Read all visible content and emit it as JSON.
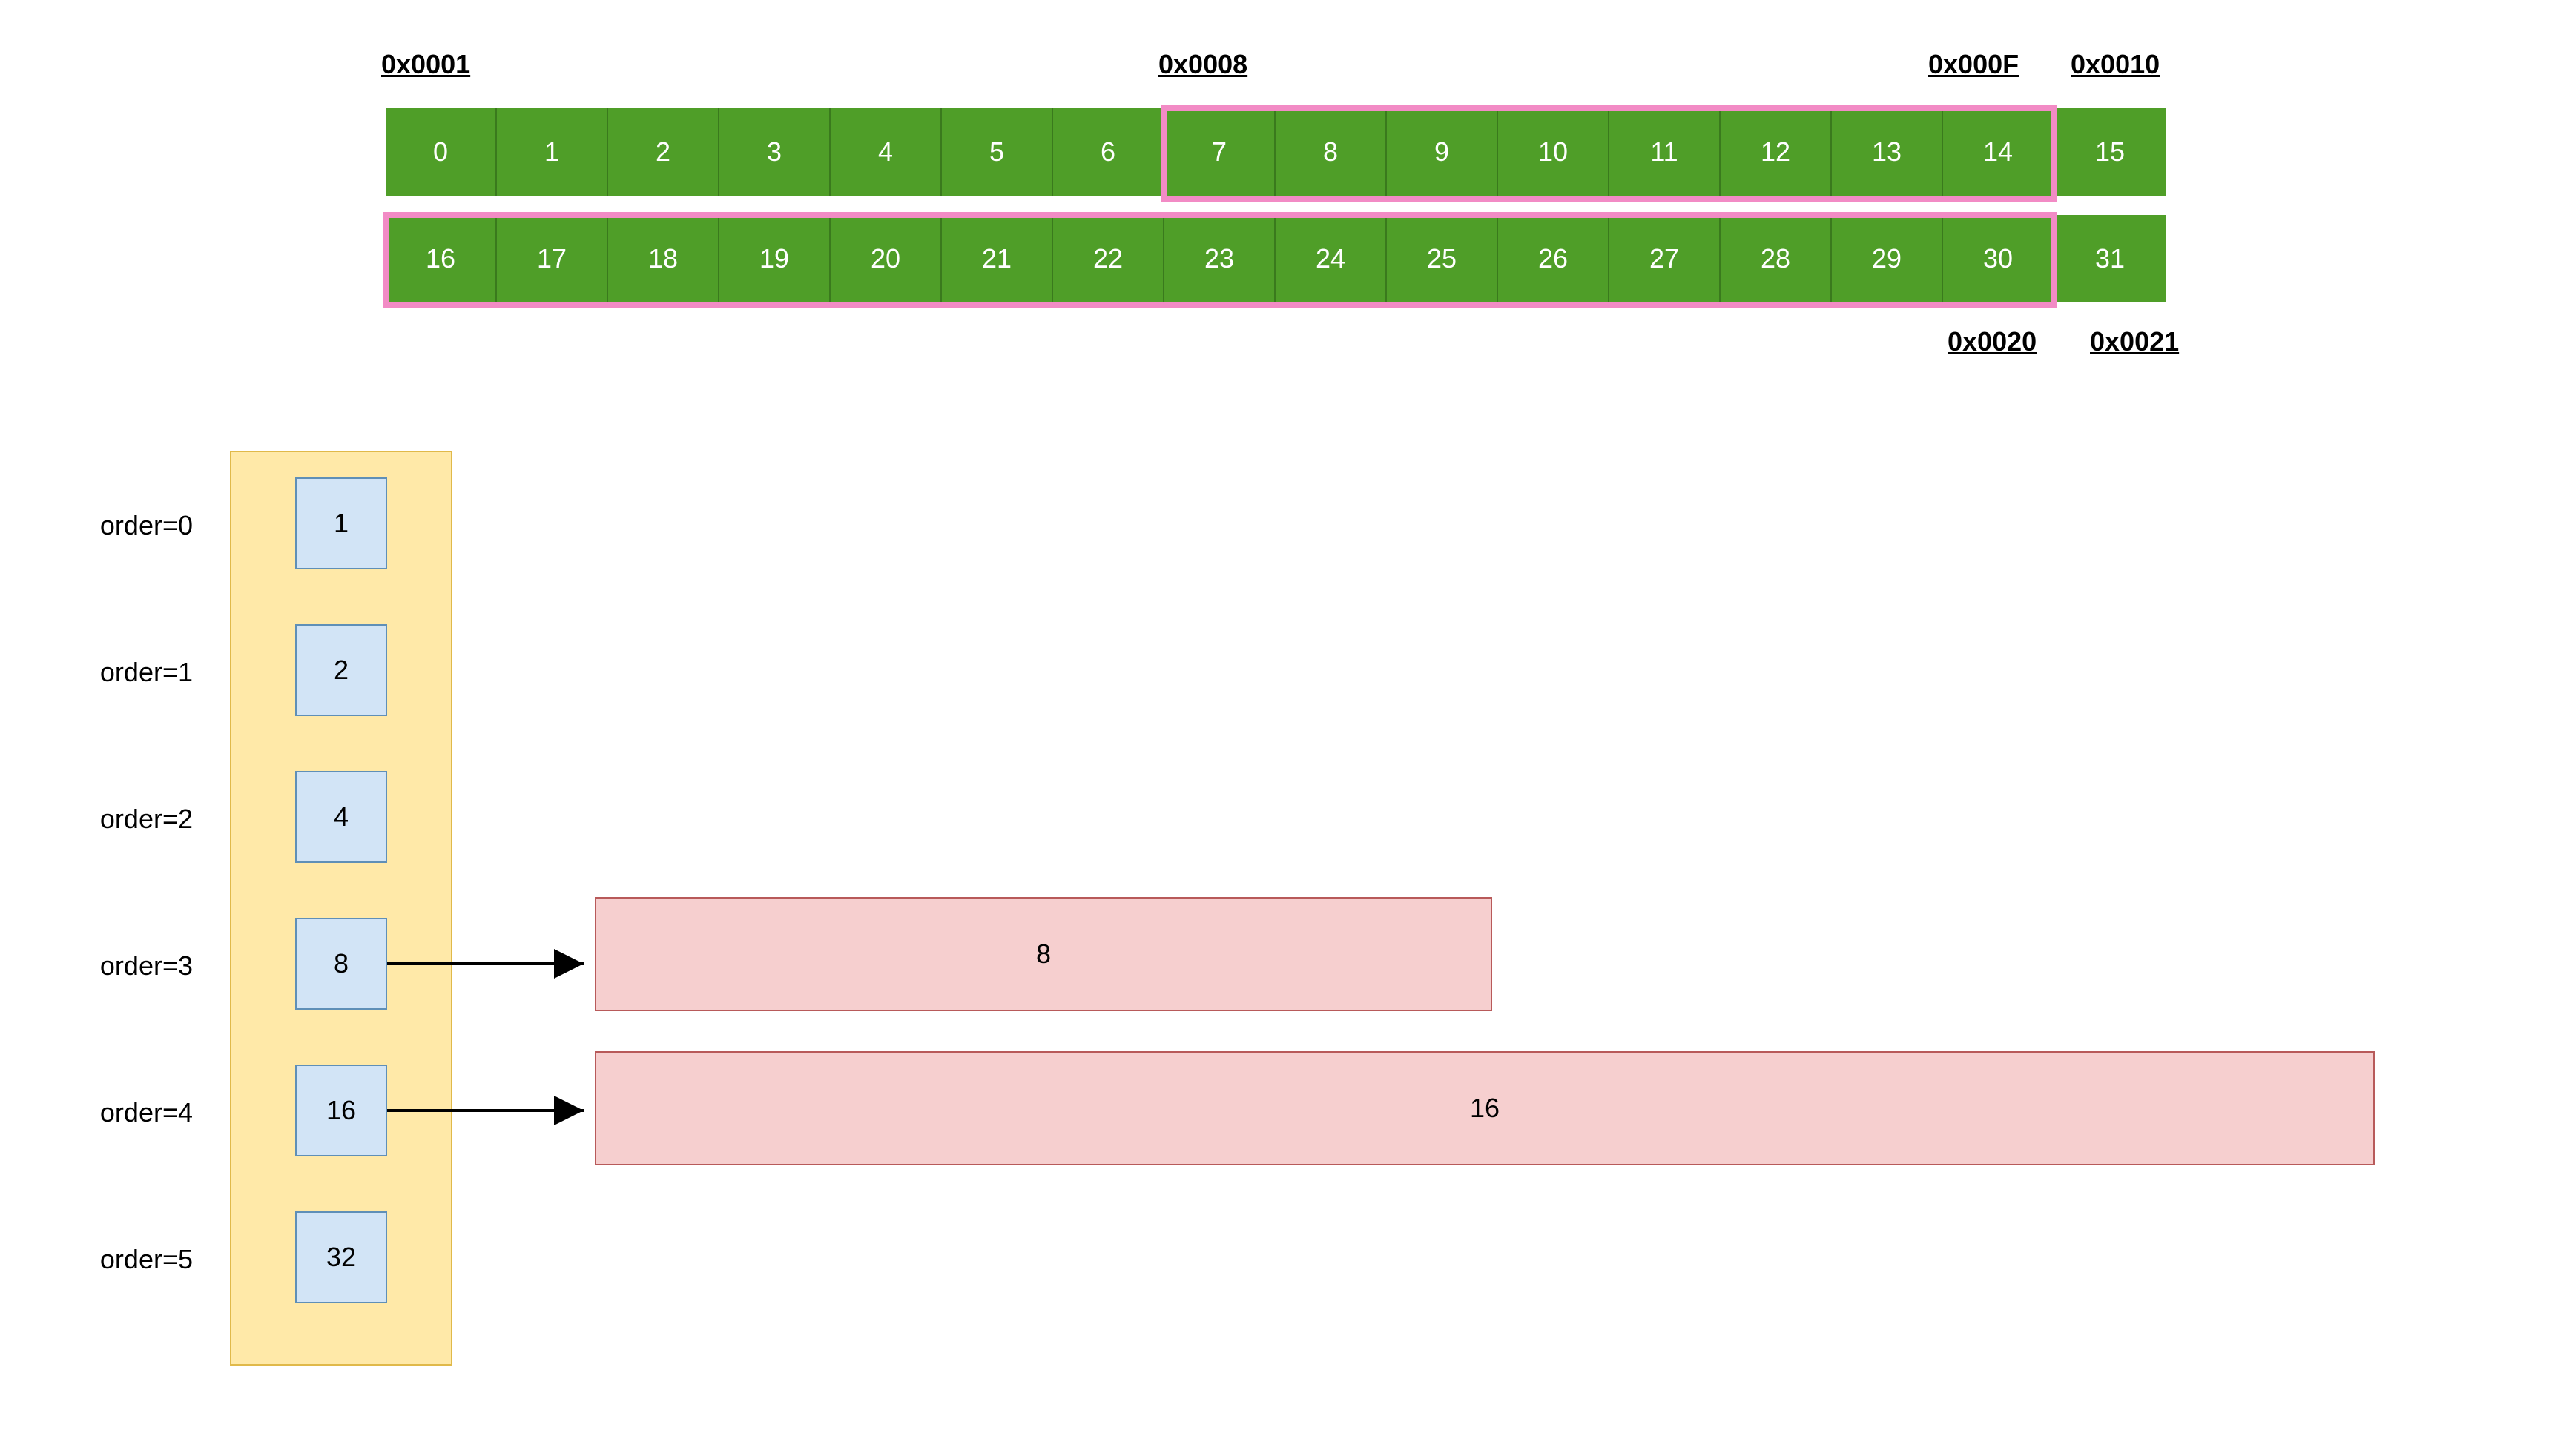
{
  "memory": {
    "addresses": {
      "a1": "0x0001",
      "a2": "0x0008",
      "a3": "0x000F",
      "a4": "0x0010",
      "a5": "0x0020",
      "a6": "0x0021"
    },
    "row1": [
      "0",
      "1",
      "2",
      "3",
      "4",
      "5",
      "6",
      "7",
      "8",
      "9",
      "10",
      "11",
      "12",
      "13",
      "14",
      "15"
    ],
    "row2": [
      "16",
      "17",
      "18",
      "19",
      "20",
      "21",
      "22",
      "23",
      "24",
      "25",
      "26",
      "27",
      "28",
      "29",
      "30",
      "31"
    ],
    "highlights": [
      {
        "name": "highlight-row1-7to14",
        "desc": "pink box around cells 7–14"
      },
      {
        "name": "highlight-row2-0to14",
        "desc": "pink box around cells 16–30"
      }
    ]
  },
  "orders": {
    "labels": [
      "order=0",
      "order=1",
      "order=2",
      "order=3",
      "order=4",
      "order=5"
    ],
    "values": [
      "1",
      "2",
      "4",
      "8",
      "16",
      "32"
    ]
  },
  "free_blocks": {
    "block8": "8",
    "block16": "16"
  },
  "chart_data": {
    "type": "table",
    "description": "Buddy allocator free-list diagram: 32 memory cells (0–31) with pink highlights over cells 7–14 and 16–30; order list 0..5 with sizes 1,2,4,8,16,32; arrows from order=3 (8) and order=4 (16) to free blocks of size 8 and 16.",
    "memory_cells": [
      0,
      1,
      2,
      3,
      4,
      5,
      6,
      7,
      8,
      9,
      10,
      11,
      12,
      13,
      14,
      15,
      16,
      17,
      18,
      19,
      20,
      21,
      22,
      23,
      24,
      25,
      26,
      27,
      28,
      29,
      30,
      31
    ],
    "orders": [
      {
        "order": 0,
        "size": 1,
        "free_blocks": []
      },
      {
        "order": 1,
        "size": 2,
        "free_blocks": []
      },
      {
        "order": 2,
        "size": 4,
        "free_blocks": []
      },
      {
        "order": 3,
        "size": 8,
        "free_blocks": [
          8
        ]
      },
      {
        "order": 4,
        "size": 16,
        "free_blocks": [
          16
        ]
      },
      {
        "order": 5,
        "size": 32,
        "free_blocks": []
      }
    ],
    "address_labels": [
      "0x0001",
      "0x0008",
      "0x000F",
      "0x0010",
      "0x0020",
      "0x0021"
    ]
  }
}
